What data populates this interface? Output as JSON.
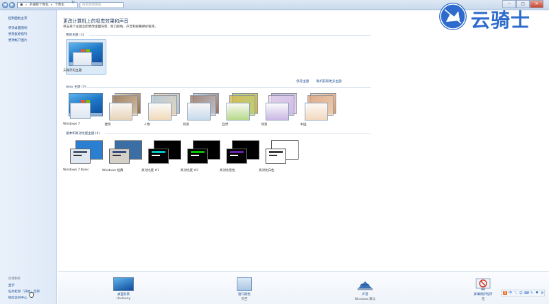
{
  "titlebar": {
    "breadcrumb": [
      "外观和个性化",
      "个性化"
    ],
    "search_placeholder": "搜索控制面板",
    "window_buttons": [
      "minimize-icon",
      "maximize-icon",
      "close-icon"
    ]
  },
  "sidebar": {
    "home": "控制面板主页",
    "links": [
      "更改桌面图标",
      "更改鼠标指针",
      "更改帐户图片"
    ],
    "see_also_heading": "另请参阅",
    "see_also": [
      "显示",
      "任务栏和「开始」菜单",
      "轻松访问中心"
    ]
  },
  "main": {
    "title": "更改计算机上的视觉效果和声音",
    "description": "单击某个主题立即更改桌面背景、窗口颜色、声音和屏幕保护程序。",
    "my_themes": {
      "heading": "我的主题 (1)",
      "items": [
        {
          "label": "未保存的主题"
        }
      ],
      "save_link": "保存主题",
      "online_link": "联机获取更多主题"
    },
    "aero_themes": {
      "heading": "Aero 主题 (7)",
      "items": [
        {
          "label": "Windows 7",
          "colors": [
            "#2a7fd0",
            "#0e4a9b"
          ]
        },
        {
          "label": "建筑",
          "colors": [
            "#e8d2b6",
            "#8b6f52"
          ]
        },
        {
          "label": "人物",
          "colors": [
            "#f2d9b8",
            "#a8c6dd"
          ]
        },
        {
          "label": "风景",
          "colors": [
            "#c6d9ec",
            "#9a6f59"
          ]
        },
        {
          "label": "自然",
          "colors": [
            "#b6d98a",
            "#d8b44e"
          ]
        },
        {
          "label": "场景",
          "colors": [
            "#c9b7e4",
            "#e9d6ef"
          ]
        },
        {
          "label": "中国",
          "colors": [
            "#f3d9bd",
            "#d6a07e"
          ]
        }
      ]
    },
    "basic_themes": {
      "heading": "基本和高对比度主题 (6)",
      "items": [
        {
          "label": "Windows 7 Basic",
          "bg": "#2a7fd0",
          "win": "#dfe7f1",
          "bar": "#1f2e44"
        },
        {
          "label": "Windows 经典",
          "bg": "#3b6ea5",
          "win": "#d4d0c8",
          "bar": "#0a246a"
        },
        {
          "label": "高对比度 #1",
          "bg": "#000000",
          "win": "#000000",
          "bar": "#00ffff"
        },
        {
          "label": "高对比度 #2",
          "bg": "#000000",
          "win": "#000000",
          "bar": "#00ff00"
        },
        {
          "label": "高对比黑色",
          "bg": "#000000",
          "win": "#000000",
          "bar": "#8a2be2"
        },
        {
          "label": "高对比白色",
          "bg": "#ffffff",
          "win": "#ffffff",
          "bar": "#000000"
        }
      ]
    }
  },
  "bottom": [
    {
      "title": "桌面背景",
      "value": "Harmony",
      "icon": "desktop-background-icon"
    },
    {
      "title": "窗口颜色",
      "value": "天空",
      "icon": "window-color-icon"
    },
    {
      "title": "声音",
      "value": "Windows 默认",
      "icon": "sounds-icon"
    },
    {
      "title": "屏幕保护程序",
      "value": "无",
      "icon": "screensaver-icon"
    }
  ],
  "watermark": {
    "text": "云骑士"
  },
  "tray": {
    "items": [
      "S",
      "中",
      "°,",
      "☺",
      "⌨",
      "✎",
      "♥",
      "⚙"
    ]
  }
}
